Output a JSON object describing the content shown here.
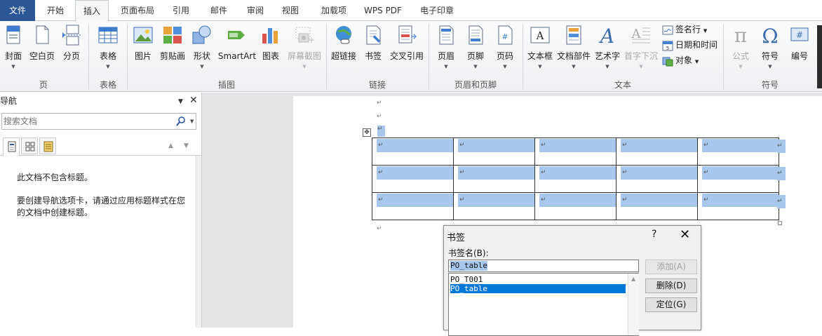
{
  "tabs": [
    "文件",
    "开始",
    "插入",
    "页面布局",
    "引用",
    "邮件",
    "审阅",
    "视图",
    "加载项",
    "WPS PDF",
    "电子印章"
  ],
  "active_tab": "插入",
  "colors": {
    "file_tab": "#2b5797",
    "selection": "#a7c8ec",
    "list_selected": "#0078d7"
  },
  "ribbon": {
    "groups": {
      "page": "页",
      "table": "表格",
      "illustrations": "插图",
      "links": "链接",
      "header_footer": "页眉和页脚",
      "text": "文本",
      "symbols": "符号"
    },
    "buttons": {
      "cover": "封面",
      "blank_page": "空白页",
      "page_break": "分页",
      "table": "表格",
      "picture": "图片",
      "clipart": "剪贴画",
      "shapes": "形状",
      "smartart": "SmartArt",
      "chart": "图表",
      "screenshot": "屏幕截图",
      "hyperlink": "超链接",
      "bookmark": "书签",
      "cross_ref": "交叉引用",
      "header": "页眉",
      "footer": "页脚",
      "page_number": "页码",
      "textbox": "文本框",
      "quick_parts": "文档部件",
      "wordart": "艺术字",
      "dropcap": "首字下沉",
      "equation": "公式",
      "symbol": "符号",
      "numbering": "编号"
    },
    "small_buttons": {
      "signature_line": "签名行",
      "date_time": "日期和时间",
      "object": "对象"
    }
  },
  "nav": {
    "title": "导航",
    "search_placeholder": "搜索文档",
    "empty_msg": "此文档不包含标题。",
    "help_msg": "要创建导航选项卡，请通过应用标题样式在您的文档中创建标题。"
  },
  "document": {
    "paragraph_mark": "↵",
    "table_rows": 3,
    "table_cols": 5
  },
  "dialog": {
    "title": "书签",
    "help": "?",
    "close": "✕",
    "name_label": "书签名(B):",
    "name_value": "PO_table",
    "list": [
      "PO_T001",
      "PO_table"
    ],
    "selected_index": 1,
    "add_button": "添加(A)",
    "delete_button": "删除(D)",
    "goto_button": "定位(G)"
  }
}
